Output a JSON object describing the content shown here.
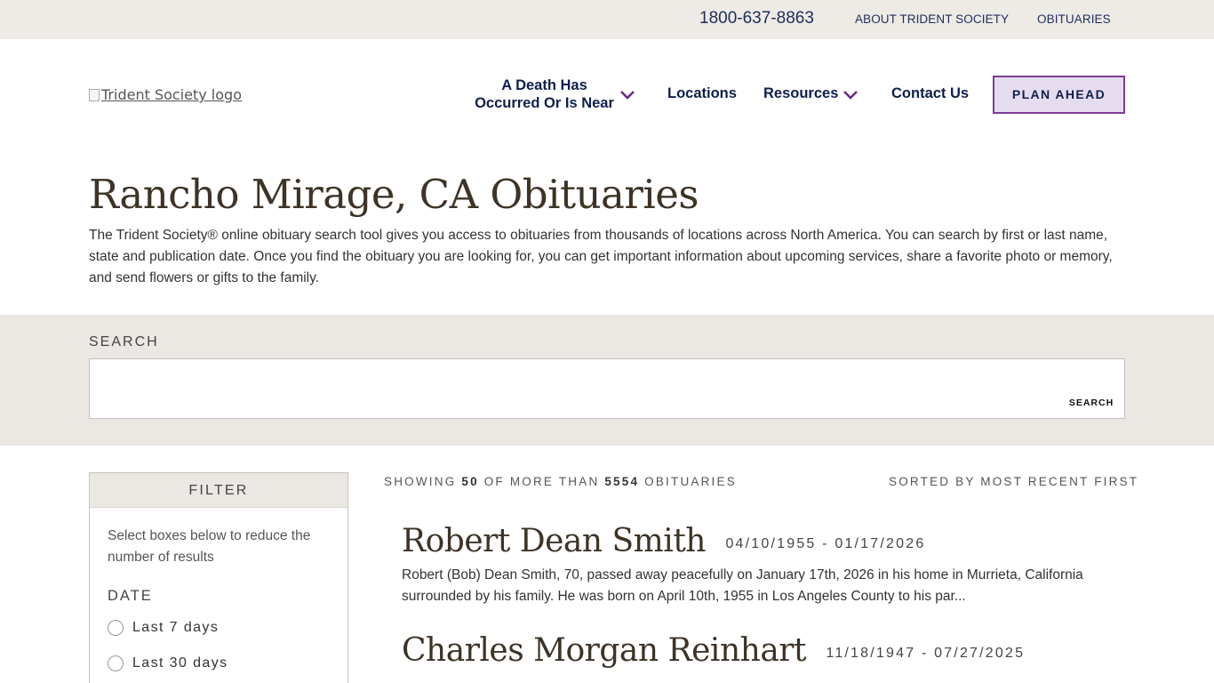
{
  "topbar": {
    "phone": "1800-637-8863",
    "about": "ABOUT TRIDENT SOCIETY",
    "obituaries": "OBITUARIES"
  },
  "header": {
    "logo_alt": "Trident Society logo",
    "nav": {
      "death_line1": "A Death Has",
      "death_line2": "Occurred Or Is Near",
      "locations": "Locations",
      "resources": "Resources",
      "contact": "Contact Us"
    },
    "plan_button": "PLAN AHEAD"
  },
  "page": {
    "title": "Rancho Mirage, CA Obituaries",
    "intro": "The Trident Society® online obituary search tool gives you access to obituaries from thousands of locations across North America. You can search by first or last name, state and publication date. Once you find the obituary you are looking for, you can get important information about upcoming services, share a favorite photo or memory, and send flowers or gifts to the family."
  },
  "search": {
    "label": "SEARCH",
    "value": "",
    "placeholder": "",
    "button": "SEARCH"
  },
  "filter": {
    "title": "FILTER",
    "hint": "Select boxes below to reduce the number of results",
    "date_label": "DATE",
    "options": [
      {
        "label": "Last 7 days",
        "checked": false
      },
      {
        "label": "Last 30 days",
        "checked": false
      }
    ]
  },
  "results": {
    "showing_prefix": "SHOWING",
    "showing_count": "50",
    "showing_middle": "OF MORE THAN",
    "total_count": "5554",
    "showing_suffix": "OBITUARIES",
    "sorted": "SORTED BY MOST RECENT FIRST",
    "obituaries": [
      {
        "name": "Robert Dean Smith",
        "dates": "04/10/1955 - 01/17/2026",
        "excerpt": "Robert (Bob) Dean Smith, 70, passed away peacefully on January 17th, 2026 in his home in Murrieta, California surrounded by his family. He was born on April 10th, 1955 in Los Angeles County to his par..."
      },
      {
        "name": "Charles Morgan Reinhart",
        "dates": "11/18/1947 - 07/27/2025",
        "excerpt": ""
      }
    ]
  },
  "colors": {
    "navy": "#0f1f4a",
    "purple_accent": "#7b3d96",
    "band_bg": "#ebe8e3",
    "title_brown": "#3d3326"
  }
}
